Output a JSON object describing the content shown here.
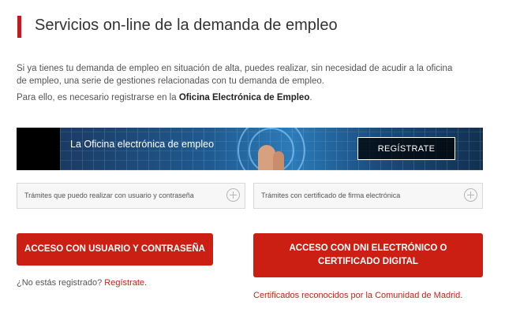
{
  "header": {
    "title": "Servicios on-line de la demanda de empleo"
  },
  "intro": {
    "paragraph1": "Si ya tienes tu demanda de empleo en situación de alta, puedes realizar, sin necesidad de acudir a la oficina de empleo, una serie de gestiones relacionadas con tu demanda de empleo.",
    "paragraph2_prefix": "Para ello, es necesario registrarse  en la ",
    "paragraph2_bold": "Oficina Electrónica de Empleo",
    "paragraph2_suffix": "."
  },
  "banner": {
    "text": "La Oficina electrónica de empleo",
    "button_label": "REGÍSTRATE"
  },
  "accordions": [
    {
      "label": "Trámites que puedo realizar con usuario y contraseña",
      "icon": "plus-circle-icon"
    },
    {
      "label": "Trámites con certificado de firma electrónica",
      "icon": "plus-circle-icon"
    }
  ],
  "actions": {
    "user_password_button": "ACCESO CON USUARIO Y CONTRASEÑA",
    "dni_button": "ACCESO CON DNI ELECTRÓNICO O CERTIFICADO DIGITAL",
    "not_registered_text": "¿No estás registrado?",
    "register_link": "Regístrate.",
    "certificates_link": "Certificados reconocidos por la Comunidad de Madrid."
  },
  "colors": {
    "accent_red": "#cc1f14",
    "title_bar_red": "#c8161d",
    "text_gray": "#555555"
  }
}
